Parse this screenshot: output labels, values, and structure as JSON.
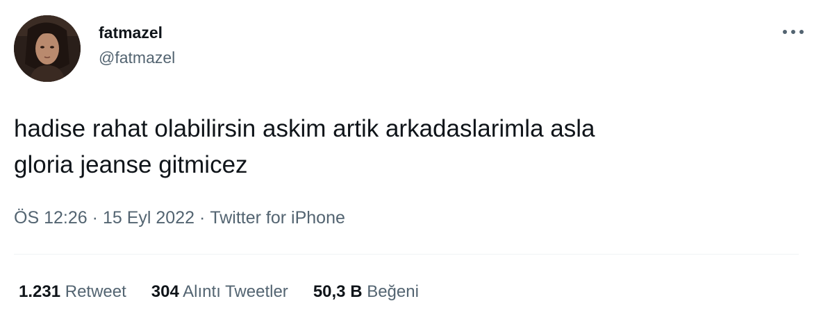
{
  "author": {
    "display_name": "fatmazel",
    "handle": "@fatmazel"
  },
  "tweet": {
    "text_line_1": "hadise rahat olabilirsin askim artik arkadaslarimla asla",
    "text_line_2": "gloria jeanse gitmicez"
  },
  "meta": {
    "time": "ÖS 12:26",
    "separator": "·",
    "date": "15 Eyl 2022",
    "source": "Twitter for iPhone"
  },
  "stats": {
    "retweets_count": "1.231",
    "retweets_label": "Retweet",
    "quotes_count": "304",
    "quotes_label": "Alıntı Tweetler",
    "likes_count": "50,3 B",
    "likes_label": "Beğeni"
  },
  "icons": {
    "more": "more-horizontal-icon"
  },
  "colors": {
    "primary_text": "#0f1419",
    "secondary_text": "#536471",
    "divider": "#eff3f4"
  }
}
